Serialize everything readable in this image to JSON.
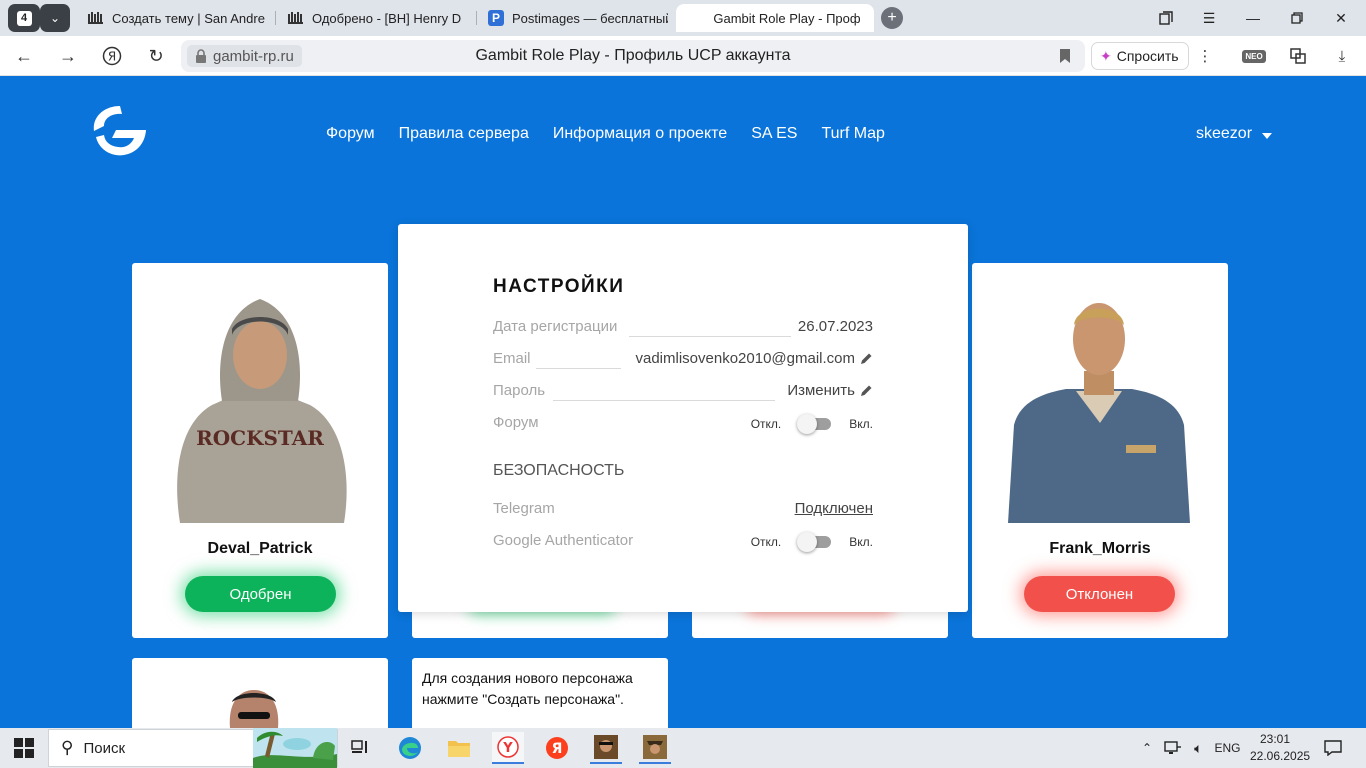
{
  "browser": {
    "tab_count": "4",
    "tabs": [
      {
        "label": "Создать тему | San Andre",
        "icon": "forum-icon"
      },
      {
        "label": "Одобрено - [BH] Henry D",
        "icon": "forum-icon"
      },
      {
        "label": "Postimages — бесплатный",
        "icon": "postimages-icon"
      },
      {
        "label": "Gambit Role Play - Проф",
        "icon": "gambit-icon",
        "active": true
      }
    ],
    "domain": "gambit-rp.ru",
    "page_title": "Gambit Role Play - Профиль UCP аккаунта",
    "ask_label": "Спросить",
    "neo_label": "NEO"
  },
  "site": {
    "nav": [
      "Форум",
      "Правила сервера",
      "Информация о проекте",
      "SA ES",
      "Turf Map"
    ],
    "username": "skeezor",
    "accent": "#0a74da"
  },
  "characters": [
    {
      "name": "Deval_Patrick",
      "status": "Одобрен",
      "status_color": "#0cb35a"
    },
    {
      "name": "Frank_Morris",
      "status": "Отклонен",
      "status_color": "#f2504b"
    }
  ],
  "create_hint": "Для создания нового персонажа нажмите \"Создать персонажа\".",
  "settings": {
    "title": "НАСТРОЙКИ",
    "reg_label": "Дата регистрации",
    "reg_value": "26.07.2023",
    "email_label": "Email",
    "email_value": "vadimlisovenko2010@gmail.com",
    "password_label": "Пароль",
    "password_value": "Изменить",
    "forum_label": "Форум",
    "off_label": "Откл.",
    "on_label": "Вкл.",
    "security_title": "БЕЗОПАСНОСТЬ",
    "telegram_label": "Telegram",
    "telegram_value": "Подключен",
    "gauth_label": "Google Authenticator"
  },
  "taskbar": {
    "search_label": "Поиск",
    "lang": "ENG",
    "time": "23:01",
    "date": "22.06.2025"
  }
}
